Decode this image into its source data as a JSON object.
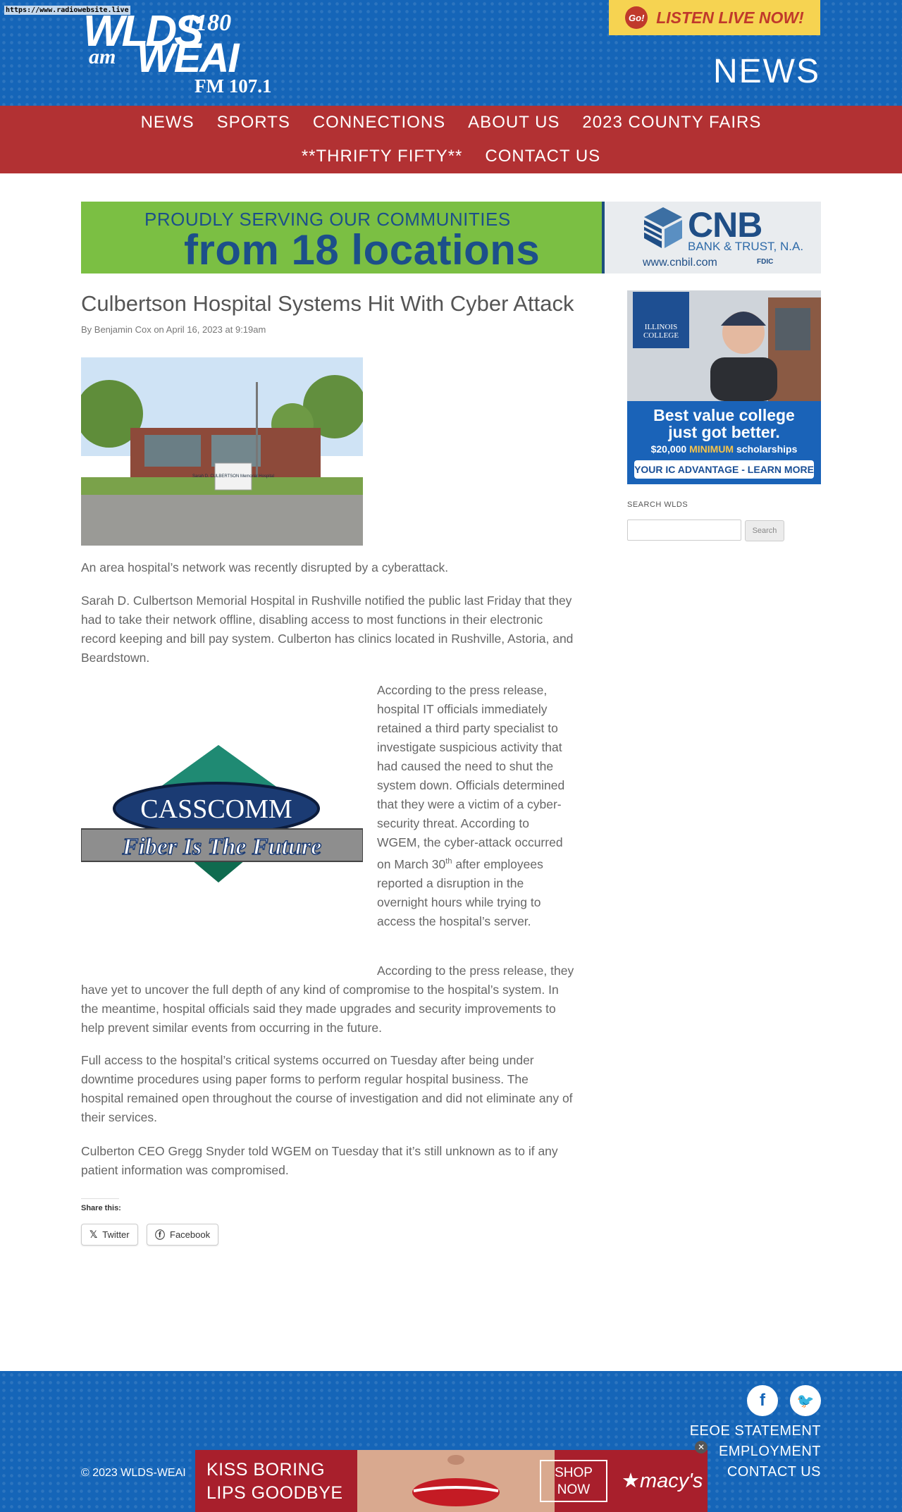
{
  "browser": {
    "url_text": "https://www.radiowebsite.live"
  },
  "header": {
    "logo": {
      "wlds": "WLDS",
      "n1180": "1180",
      "am": "am",
      "weai": "WEAI",
      "fm": "FM 107.1"
    },
    "listen": {
      "go": "Go!",
      "label": "LISTEN LIVE NOW!"
    },
    "section_title": "NEWS"
  },
  "nav": {
    "row1": [
      "NEWS",
      "SPORTS",
      "CONNECTIONS",
      "ABOUT US",
      "2023 COUNTY FAIRS"
    ],
    "row2": [
      "**THRIFTY FIFTY**",
      "CONTACT US"
    ]
  },
  "banner": {
    "line1": "PROUDLY SERVING OUR COMMUNITIES",
    "line2": "from 18 locations",
    "bank_name": "CNB",
    "bank_sub": "BANK & TRUST, N.A.",
    "bank_url": "www.cnbil.com",
    "fdic": "FDIC"
  },
  "article": {
    "title": "Culbertson Hospital Systems Hit With Cyber Attack",
    "byline": "By Benjamin Cox on April 16, 2023 at 9:19am",
    "p1": "An area hospital’s network was recently disrupted by a cyberattack.",
    "p2": "Sarah D. Culbertson Memorial Hospital in Rushville notified the public last Friday that they had to take their network offline, disabling access to most functions in their electronic record keeping and bill pay system. Culberton has clinics located in Rushville, Astoria, and Beardstown.",
    "p3_before": "According to the press release, hospital IT officials immediately retained a third party specialist to investigate suspicious activity that had caused the need to shut the system down. Officials determined that they were a victim of a cyber-security threat. According to WGEM, the cyber-attack occurred on March 30",
    "p3_sup": "th",
    "p3_after": " after employees reported a disruption in the overnight hours while trying to access the hospital’s server.",
    "p4a": "According to the press release,",
    "p4b": "they have yet to uncover the full depth of any kind of compromise to the hospital’s system. In the meantime, hospital officials said they made upgrades and security improvements to help prevent similar events from occurring in the future.",
    "p5": "Full access to the hospital’s critical systems occurred on Tuesday after being under downtime procedures using paper forms to perform regular hospital business. The hospital remained open throughout the course of investigation and did not eliminate any of their services.",
    "p6": "Culberton CEO Gregg Snyder told WGEM on Tuesday that it’s still unknown as to if any patient information was compromised.",
    "photo_sign": "Sarah D. CULBERTSON Memorial Hospital",
    "casscomm_name": "CASSCOMM",
    "casscomm_tag": "Fiber Is The Future"
  },
  "share": {
    "label": "Share this:",
    "twitter": "Twitter",
    "facebook": "Facebook"
  },
  "sidebar": {
    "ad": {
      "college": "ILLINOIS COLLEGE",
      "headline1": "Best value college",
      "headline2": "just got better.",
      "sub_amount": "$20,000",
      "sub_min": "MINIMUM",
      "sub_rest": "scholarships",
      "cta": "YOUR IC ADVANTAGE - LEARN MORE"
    },
    "search_label": "SEARCH WLDS",
    "search_button": "Search"
  },
  "footer": {
    "links": [
      "EEOE STATEMENT",
      "EMPLOYMENT",
      "CONTACT US"
    ],
    "copyright": "© 2023 WLDS-WEAI"
  },
  "bottom_ad": {
    "line1": "KISS BORING",
    "line2": "LIPS GOODBYE",
    "shop1": "SHOP",
    "shop2": "NOW",
    "brand": "★macy's"
  },
  "colors": {
    "header_blue": "#1565b8",
    "nav_red": "#b23133",
    "listen_yellow": "#f6d351",
    "banner_green": "#7bbf43"
  }
}
